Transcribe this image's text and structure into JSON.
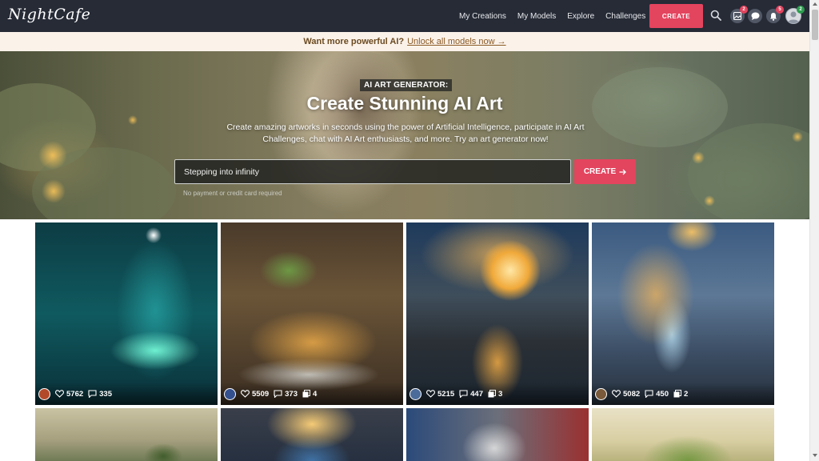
{
  "nav": {
    "logo": "NightCafe",
    "links": [
      "My Creations",
      "My Models",
      "Explore",
      "Challenges"
    ],
    "create_label": "CREATE",
    "badges": {
      "gallery": "2",
      "notifications": "5",
      "profile": "2"
    }
  },
  "promo": {
    "bold": "Want more powerful AI?",
    "link": "Unlock all models now →"
  },
  "hero": {
    "tag": "AI ART GENERATOR:",
    "title": "Create Stunning AI Art",
    "description": "Create amazing artworks in seconds using the power of Artificial Intelligence, participate in AI Art Challenges, chat with AI Art enthusiasts, and more. Try an art generator now!",
    "input_value": "Stepping into infinity",
    "create_label": "CREATE",
    "note": "No payment or credit card required"
  },
  "gallery": [
    {
      "likes": "5762",
      "comments": "335",
      "images": ""
    },
    {
      "likes": "5509",
      "comments": "373",
      "images": "4"
    },
    {
      "likes": "5215",
      "comments": "447",
      "images": "3"
    },
    {
      "likes": "5082",
      "comments": "450",
      "images": "2"
    }
  ]
}
